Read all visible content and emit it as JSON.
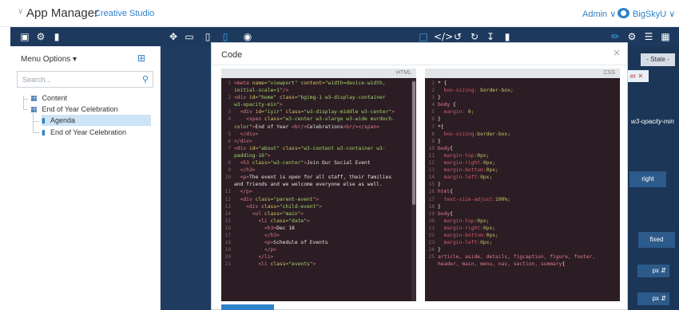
{
  "topbar": {
    "app_title": "App Manager",
    "studio": "Creative Studio",
    "admin": "Admin",
    "user": "BigSkyU"
  },
  "toolbar": {
    "icons": [
      "save-icon",
      "gear-icon",
      "trash-icon",
      "fullscreen-icon",
      "desktop-icon",
      "tablet-icon",
      "mobile-icon",
      "eye-icon",
      "square-icon",
      "code-icon",
      "undo-icon",
      "redo-icon",
      "download-icon",
      "delete-icon",
      "brush-icon",
      "settings-icon",
      "list-icon",
      "blocks-icon"
    ]
  },
  "left": {
    "menu_label": "Menu Options",
    "search_placeholder": "Search...",
    "tree": [
      "Content",
      "End of Year Celebration",
      "Agenda",
      "End of Year Celebration"
    ]
  },
  "right": {
    "state": "- State -",
    "tag": "er",
    "opacity_class": "w3-opacity-min",
    "right_btn": "right",
    "fixed_btn": "fixed",
    "px1": "px",
    "px2": "px"
  },
  "modal": {
    "title": "Code",
    "close": "×",
    "html_label": "HTML",
    "css_label": "CSS"
  },
  "code": {
    "html": [
      [
        1,
        [
          [
            "t",
            "<meta "
          ],
          [
            "a",
            "name="
          ],
          [
            "s",
            "\"viewport\" "
          ],
          [
            "a",
            "content="
          ],
          [
            "s",
            "\"width=device-width,"
          ]
        ]
      ],
      [
        0,
        [
          [
            "s",
            "initial-scale=1\""
          ],
          [
            "t",
            "/>"
          ]
        ]
      ],
      [
        2,
        [
          [
            "t",
            "<div "
          ],
          [
            "a",
            "id="
          ],
          [
            "s",
            "\"home\" "
          ],
          [
            "a",
            "class="
          ],
          [
            "s",
            "\"bgimg-1 w3-display-container"
          ]
        ]
      ],
      [
        0,
        [
          [
            "s",
            "w3-opacity-min\""
          ],
          [
            "t",
            ">"
          ]
        ]
      ],
      [
        3,
        [
          [
            "x",
            "  "
          ],
          [
            "t",
            "<div "
          ],
          [
            "a",
            "id="
          ],
          [
            "s",
            "\"iyir\" "
          ],
          [
            "a",
            "class="
          ],
          [
            "s",
            "\"w3-display-middle w3-center\""
          ],
          [
            "t",
            ">"
          ]
        ]
      ],
      [
        4,
        [
          [
            "x",
            "    "
          ],
          [
            "t",
            "<span "
          ],
          [
            "a",
            "class="
          ],
          [
            "s",
            "\"w3-center w3-xlarge w3-wide murdoch-"
          ]
        ]
      ],
      [
        0,
        [
          [
            "s",
            "color\""
          ],
          [
            "t",
            ">"
          ],
          [
            "x",
            "End of Year "
          ],
          [
            "t",
            "<br/>"
          ],
          [
            "x",
            "Celebrations"
          ],
          [
            "t",
            "<br/></span>"
          ]
        ]
      ],
      [
        5,
        [
          [
            "x",
            "  "
          ],
          [
            "t",
            "</div>"
          ]
        ]
      ],
      [
        6,
        [
          [
            "t",
            "</div>"
          ]
        ]
      ],
      [
        7,
        [
          [
            "t",
            "<div "
          ],
          [
            "a",
            "id="
          ],
          [
            "s",
            "\"about\" "
          ],
          [
            "a",
            "class="
          ],
          [
            "s",
            "\"w3-content w3-container w3-"
          ]
        ]
      ],
      [
        0,
        [
          [
            "s",
            "padding-16\""
          ],
          [
            "t",
            ">"
          ]
        ]
      ],
      [
        8,
        [
          [
            "x",
            "  "
          ],
          [
            "t",
            "<h3 "
          ],
          [
            "a",
            "class="
          ],
          [
            "s",
            "\"w3-center\""
          ],
          [
            "t",
            ">"
          ],
          [
            "x",
            "Join Our Social Event"
          ]
        ]
      ],
      [
        9,
        [
          [
            "x",
            "  "
          ],
          [
            "t",
            "</h3>"
          ]
        ]
      ],
      [
        10,
        [
          [
            "x",
            "  "
          ],
          [
            "t",
            "<p>"
          ],
          [
            "x",
            "The event is open for all staff, their families"
          ]
        ]
      ],
      [
        0,
        [
          [
            "x",
            "and friends and we welcome everyone else as well."
          ]
        ]
      ],
      [
        11,
        [
          [
            "x",
            "  "
          ],
          [
            "t",
            "</p>"
          ]
        ]
      ],
      [
        12,
        [
          [
            "x",
            "  "
          ],
          [
            "t",
            "<div "
          ],
          [
            "a",
            "class="
          ],
          [
            "s",
            "\"parent-event\""
          ],
          [
            "t",
            ">"
          ]
        ]
      ],
      [
        13,
        [
          [
            "x",
            "    "
          ],
          [
            "t",
            "<div "
          ],
          [
            "a",
            "class="
          ],
          [
            "s",
            "\"child-event\""
          ],
          [
            "t",
            ">"
          ]
        ]
      ],
      [
        14,
        [
          [
            "x",
            "      "
          ],
          [
            "t",
            "<ul "
          ],
          [
            "a",
            "class="
          ],
          [
            "s",
            "\"main\""
          ],
          [
            "t",
            ">"
          ]
        ]
      ],
      [
        15,
        [
          [
            "x",
            "        "
          ],
          [
            "t",
            "<li "
          ],
          [
            "a",
            "class="
          ],
          [
            "s",
            "\"date\""
          ],
          [
            "t",
            ">"
          ]
        ]
      ],
      [
        16,
        [
          [
            "x",
            "          "
          ],
          [
            "t",
            "<h3>"
          ],
          [
            "x",
            "Dec 18"
          ]
        ]
      ],
      [
        17,
        [
          [
            "x",
            "          "
          ],
          [
            "t",
            "</h3>"
          ]
        ]
      ],
      [
        18,
        [
          [
            "x",
            "          "
          ],
          [
            "t",
            "<p>"
          ],
          [
            "x",
            "Schedule of Events"
          ]
        ]
      ],
      [
        19,
        [
          [
            "x",
            "          "
          ],
          [
            "t",
            "</p>"
          ]
        ]
      ],
      [
        20,
        [
          [
            "x",
            "        "
          ],
          [
            "t",
            "</li>"
          ]
        ]
      ],
      [
        21,
        [
          [
            "x",
            "        "
          ],
          [
            "t",
            "<li "
          ],
          [
            "a",
            "class="
          ],
          [
            "s",
            "\"events\""
          ],
          [
            "t",
            ">"
          ]
        ]
      ]
    ],
    "css": [
      [
        1,
        [
          [
            "x",
            "* {"
          ]
        ]
      ],
      [
        2,
        [
          [
            "x",
            "  "
          ],
          [
            "p",
            "box-sizing:"
          ],
          [
            "v",
            " border-box;"
          ]
        ]
      ],
      [
        3,
        [
          [
            "x",
            "}"
          ]
        ]
      ],
      [
        4,
        [
          [
            "t",
            "body"
          ],
          [
            "x",
            " {"
          ]
        ]
      ],
      [
        5,
        [
          [
            "x",
            "  "
          ],
          [
            "p",
            "margin:"
          ],
          [
            "v",
            " 0;"
          ]
        ]
      ],
      [
        6,
        [
          [
            "x",
            "}"
          ]
        ]
      ],
      [
        7,
        [
          [
            "x",
            "*{"
          ]
        ]
      ],
      [
        8,
        [
          [
            "x",
            "  "
          ],
          [
            "p",
            "box-sizing:"
          ],
          [
            "v",
            "border-box;"
          ]
        ]
      ],
      [
        9,
        [
          [
            "x",
            "}"
          ]
        ]
      ],
      [
        10,
        [
          [
            "t",
            "body"
          ],
          [
            "x",
            "{"
          ]
        ]
      ],
      [
        11,
        [
          [
            "x",
            "  "
          ],
          [
            "p",
            "margin-top:"
          ],
          [
            "v",
            "0px;"
          ]
        ]
      ],
      [
        12,
        [
          [
            "x",
            "  "
          ],
          [
            "p",
            "margin-right:"
          ],
          [
            "v",
            "0px;"
          ]
        ]
      ],
      [
        13,
        [
          [
            "x",
            "  "
          ],
          [
            "p",
            "margin-bottom:"
          ],
          [
            "v",
            "0px;"
          ]
        ]
      ],
      [
        14,
        [
          [
            "x",
            "  "
          ],
          [
            "p",
            "margin-left:"
          ],
          [
            "v",
            "0px;"
          ]
        ]
      ],
      [
        15,
        [
          [
            "x",
            "}"
          ]
        ]
      ],
      [
        16,
        [
          [
            "t",
            "html"
          ],
          [
            "x",
            "{"
          ]
        ]
      ],
      [
        17,
        [
          [
            "x",
            "  "
          ],
          [
            "p",
            "text-size-adjust:"
          ],
          [
            "v",
            "100%;"
          ]
        ]
      ],
      [
        18,
        [
          [
            "x",
            "}"
          ]
        ]
      ],
      [
        19,
        [
          [
            "t",
            "body"
          ],
          [
            "x",
            "{"
          ]
        ]
      ],
      [
        20,
        [
          [
            "x",
            "  "
          ],
          [
            "p",
            "margin-top:"
          ],
          [
            "v",
            "0px;"
          ]
        ]
      ],
      [
        21,
        [
          [
            "x",
            "  "
          ],
          [
            "p",
            "margin-right:"
          ],
          [
            "v",
            "0px;"
          ]
        ]
      ],
      [
        22,
        [
          [
            "x",
            "  "
          ],
          [
            "p",
            "margin-bottom:"
          ],
          [
            "v",
            "0px;"
          ]
        ]
      ],
      [
        23,
        [
          [
            "x",
            "  "
          ],
          [
            "p",
            "margin-left:"
          ],
          [
            "v",
            "0px;"
          ]
        ]
      ],
      [
        24,
        [
          [
            "x",
            "}"
          ]
        ]
      ],
      [
        25,
        [
          [
            "t",
            "article, aside, details, figcaption, figure, footer,"
          ]
        ]
      ],
      [
        0,
        [
          [
            "t",
            "header, main, menu, nav, section, summary"
          ],
          [
            "x",
            "{"
          ]
        ]
      ]
    ]
  }
}
